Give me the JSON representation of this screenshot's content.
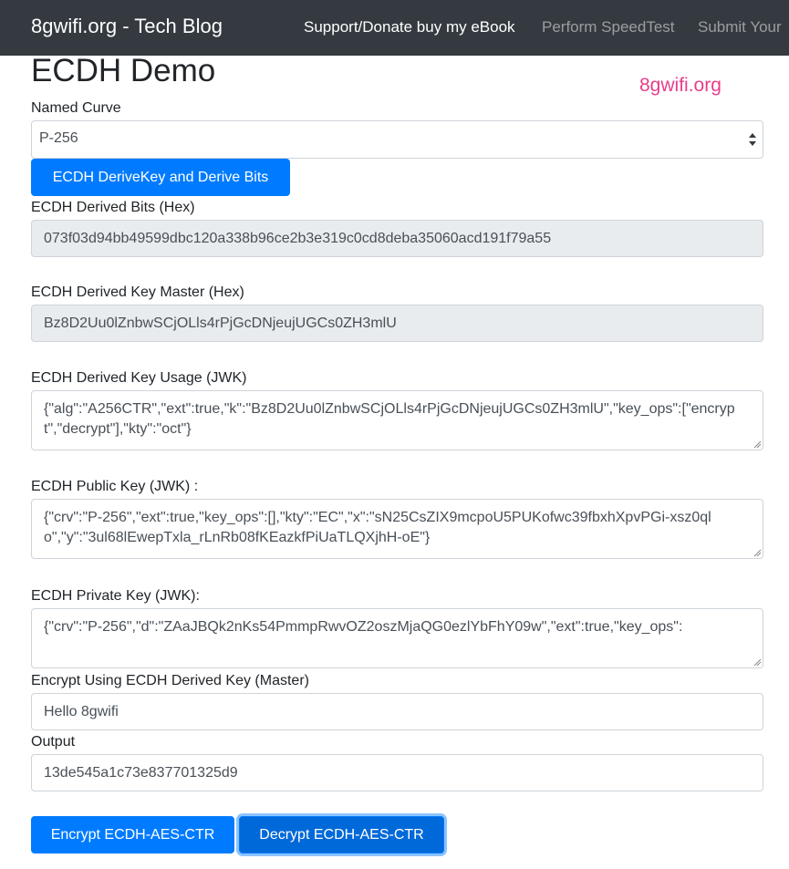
{
  "navbar": {
    "brand": "8gwifi.org - Tech Blog",
    "links": [
      {
        "label": "Support/Donate buy my eBook",
        "active": true
      },
      {
        "label": "Perform SpeedTest",
        "active": false
      },
      {
        "label": "Submit Your",
        "active": false
      }
    ]
  },
  "page": {
    "title": "ECDH Demo",
    "brand_tag": "8gwifi.org"
  },
  "form": {
    "curve": {
      "label": "Named Curve",
      "value": "P-256"
    },
    "derive_button": "ECDH DeriveKey and Derive Bits",
    "derived_bits": {
      "label": "ECDH Derived Bits (Hex)",
      "value": "073f03d94bb49599dbc120a338b96ce2b3e319c0cd8deba35060acd191f79a55"
    },
    "derived_key_master": {
      "label": "ECDH Derived Key Master (Hex)",
      "value": "Bz8D2Uu0lZnbwSCjOLls4rPjGcDNjeujUGCs0ZH3mlU"
    },
    "derived_key_usage": {
      "label": "ECDH Derived Key Usage (JWK)",
      "value": "{\"alg\":\"A256CTR\",\"ext\":true,\"k\":\"Bz8D2Uu0lZnbwSCjOLls4rPjGcDNjeujUGCs0ZH3mlU\",\"key_ops\":[\"encrypt\",\"decrypt\"],\"kty\":\"oct\"}"
    },
    "public_key": {
      "label": "ECDH Public Key (JWK) :",
      "value": "{\"crv\":\"P-256\",\"ext\":true,\"key_ops\":[],\"kty\":\"EC\",\"x\":\"sN25CsZIX9mcpoU5PUKofwc39fbxhXpvPGi-xsz0qlo\",\"y\":\"3ul68lEwepTxla_rLnRb08fKEazkfPiUaTLQXjhH-oE\"}"
    },
    "private_key": {
      "label": "ECDH Private Key (JWK):",
      "value": "{\"crv\":\"P-256\",\"d\":\"ZAaJBQk2nKs54PmmpRwvOZ2oszMjaQG0ezlYbFhY09w\",\"ext\":true,\"key_ops\":"
    },
    "encrypt_input": {
      "label": "Encrypt Using ECDH Derived Key (Master)",
      "value": "Hello 8gwifi"
    },
    "output": {
      "label": "Output",
      "value": "13de545a1c73e837701325d9"
    },
    "encrypt_button": "Encrypt ECDH-AES-CTR",
    "decrypt_button": "Decrypt ECDH-AES-CTR"
  },
  "colors": {
    "navbar_bg": "#343a40",
    "primary": "#007bff",
    "brand_tag": "#e83e8c",
    "readonly_bg": "#e9ecef"
  }
}
